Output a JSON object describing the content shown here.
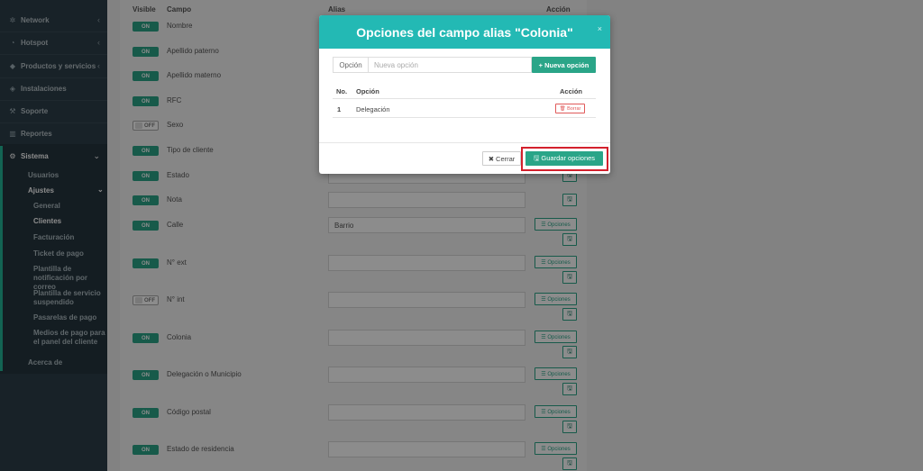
{
  "sidebar": {
    "items": [
      {
        "icon": "network-icon",
        "glyph": "✲",
        "label": "Network",
        "chevron": "‹"
      },
      {
        "icon": "wifi-icon",
        "glyph": "◔",
        "label": "Hotspot",
        "chevron": "‹"
      },
      {
        "icon": "tag-icon",
        "glyph": "◆",
        "label": "Productos y servicios",
        "chevron": "‹"
      },
      {
        "icon": "diamond-icon",
        "glyph": "◈",
        "label": "Instalaciones",
        "chevron": ""
      },
      {
        "icon": "wrench-icon",
        "glyph": "⚒",
        "label": "Soporte",
        "chevron": ""
      },
      {
        "icon": "chart-icon",
        "glyph": "▥",
        "label": "Reportes",
        "chevron": ""
      },
      {
        "icon": "gears-icon",
        "glyph": "⚙",
        "label": "Sistema",
        "chevron": "⌄"
      }
    ],
    "sub": {
      "usuarios": "Usuarios",
      "ajustes": "Ajustes",
      "ajustes_chevron": "⌄",
      "general": "General",
      "clientes": "Clientes",
      "facturacion": "Facturación",
      "ticket": "Ticket de pago",
      "plantilla_notif_1": "Plantilla de",
      "plantilla_notif_2": "notificación por correo",
      "plantilla_serv_1": "Plantilla de servicio",
      "plantilla_serv_2": "suspendido",
      "pasarelas": "Pasarelas de pago",
      "medios_1": "Medios de pago para",
      "medios_2": "el panel del cliente",
      "acerca": "Acerca de"
    }
  },
  "table": {
    "headers": {
      "visible": "Visible",
      "campo": "Campo",
      "alias": "Alias",
      "accion": "Acción"
    },
    "toggle_on": "ON",
    "toggle_off": "OFF",
    "opciones_label": "Opciones",
    "save_icon": "🖫",
    "rows": [
      {
        "name": "Nombre",
        "on": true
      },
      {
        "name": "Apellido paterno",
        "on": true
      },
      {
        "name": "Apellido materno",
        "on": true
      },
      {
        "name": "RFC",
        "on": true
      },
      {
        "name": "Sexo",
        "on": false
      },
      {
        "name": "Tipo de cliente",
        "on": true
      },
      {
        "name": "Estado",
        "on": true
      },
      {
        "name": "Nota",
        "on": true
      },
      {
        "name": "Calle",
        "on": true,
        "alias": "Barrio"
      },
      {
        "name": "N° ext",
        "on": true
      },
      {
        "name": "N° int",
        "on": false
      },
      {
        "name": "Colonia",
        "on": true
      },
      {
        "name": "Delegación o Municipio",
        "on": true
      },
      {
        "name": "Código postal",
        "on": true
      },
      {
        "name": "Estado de residencia",
        "on": true
      }
    ]
  },
  "modal": {
    "title": "Opciones del campo alias \"Colonia\"",
    "close": "×",
    "option_label": "Opción",
    "option_placeholder": "Nueva opción",
    "add_button": "+ Nueva opción",
    "col_no": "No.",
    "col_opcion": "Opción",
    "col_accion": "Acción",
    "rows": [
      {
        "no": "1",
        "opcion": "Delegación"
      }
    ],
    "delete_button": "🗑 Borrar",
    "close_button": "✖ Cerrar",
    "save_button": "🖫 Guardar opciones"
  }
}
